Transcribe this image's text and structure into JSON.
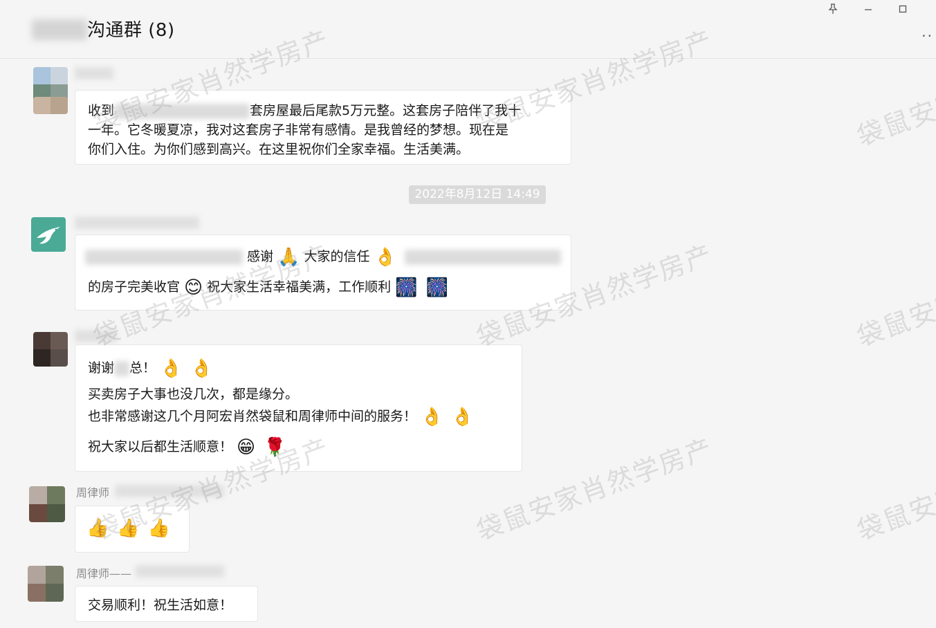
{
  "header": {
    "title": "沟通群 (8)",
    "pin_icon": "pin-icon",
    "minimize_icon": "minimize-icon",
    "maximize_icon": "maximize-icon",
    "more_label": "··"
  },
  "messages": [
    {
      "id": "m1",
      "lines": [
        {
          "before": "收到",
          "after": "套房屋最后尾款5万元整。这套房子陪伴了我十"
        },
        {
          "text": "一年。它冬暖夏凉，我对这套房子非常有感情。是我曾经的梦想。现在是"
        },
        {
          "text": "你们入住。为你们感到高兴。在这里祝你们全家幸福。生活美满。"
        }
      ]
    },
    {
      "id": "m2",
      "line1": {
        "text_a": "感谢",
        "emoji_a": "🙏",
        "text_b": "大家的信任",
        "emoji_b": "👌"
      },
      "line2": {
        "text_a": "的房子完美收官",
        "emoji_a": "😊",
        "text_b": "祝大家生活幸福美满，工作顺利",
        "emoji_b": "🎆",
        "emoji_c": "🎆"
      }
    },
    {
      "id": "m3",
      "line1": {
        "text_a": "谢谢",
        "text_b": "总！",
        "emoji_a": "👌",
        "emoji_b": "👌"
      },
      "line2": "买卖房子大事也没几次，都是缘分。",
      "line3": {
        "text": "也非常感谢这几个月阿宏肖然袋鼠和周律师中间的服务！",
        "emoji_a": "👌",
        "emoji_b": "👌"
      },
      "line4": {
        "text": "祝大家以后都生活顺意！",
        "emoji_a": "😁",
        "emoji_b": "🌹"
      }
    },
    {
      "id": "m4",
      "sender": "周律师",
      "emojis": [
        "👍",
        "👍",
        "👍"
      ]
    },
    {
      "id": "m5",
      "sender": "周律师——",
      "text": "交易顺利！祝生活如意！"
    }
  ],
  "timestamp": "2022年8月12日 14:49",
  "watermark": "袋鼠安家肖然学房产",
  "colors": {
    "background": "#f5f5f5",
    "bubble": "#ffffff",
    "timestamp_bg": "#dadada",
    "avatar_brand": "#4aaa96"
  }
}
